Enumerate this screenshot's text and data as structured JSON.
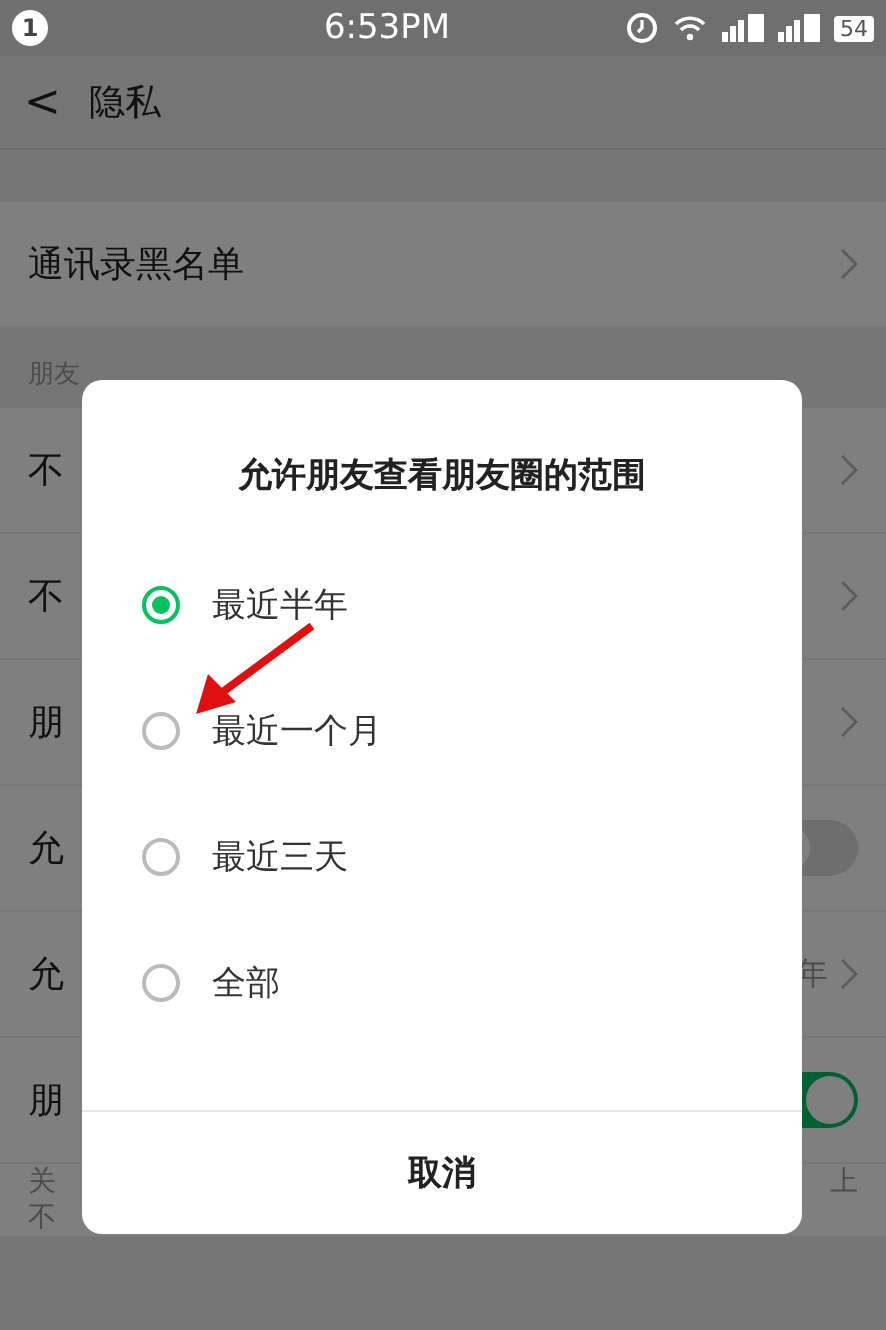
{
  "status_bar": {
    "notification": "1",
    "time": "6:53PM",
    "battery": "54"
  },
  "header": {
    "back": "<",
    "title": "隐私"
  },
  "rows_top": [
    {
      "label": "通讯录黑名单",
      "kind": "link"
    }
  ],
  "section": {
    "title": "朋友"
  },
  "rows": [
    {
      "label": "不",
      "kind": "link"
    },
    {
      "label": "不",
      "kind": "link"
    },
    {
      "label": "朋",
      "kind": "link"
    },
    {
      "label": "允",
      "kind": "toggle",
      "on": false
    },
    {
      "label": "允",
      "kind": "link",
      "value": "年"
    },
    {
      "label": "朋",
      "kind": "toggle",
      "on": true,
      "note_left": [
        "关",
        "不"
      ],
      "note_right": "上"
    }
  ],
  "dialog": {
    "title": "允许朋友查看朋友圈的范围",
    "options": [
      {
        "label": "最近半年",
        "selected": true
      },
      {
        "label": "最近一个月",
        "selected": false
      },
      {
        "label": "最近三天",
        "selected": false
      },
      {
        "label": "全部",
        "selected": false
      }
    ],
    "cancel": "取消"
  }
}
